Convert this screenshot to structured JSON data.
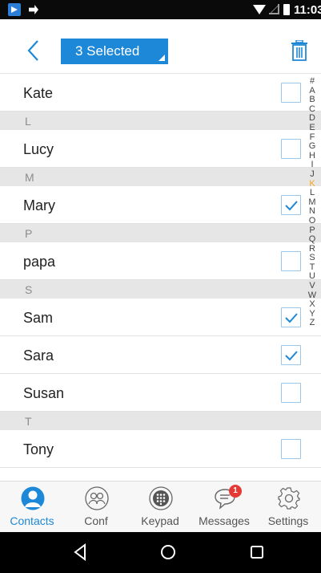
{
  "status_bar": {
    "time": "11:03"
  },
  "toolbar": {
    "selection_label": "3 Selected"
  },
  "contacts": [
    {
      "type": "contact",
      "name": "Kate",
      "checked": false
    },
    {
      "type": "section",
      "letter": "L"
    },
    {
      "type": "contact",
      "name": "Lucy",
      "checked": false
    },
    {
      "type": "section",
      "letter": "M"
    },
    {
      "type": "contact",
      "name": "Mary",
      "checked": true
    },
    {
      "type": "section",
      "letter": "P"
    },
    {
      "type": "contact",
      "name": "papa",
      "checked": false
    },
    {
      "type": "section",
      "letter": "S"
    },
    {
      "type": "contact",
      "name": "Sam",
      "checked": true
    },
    {
      "type": "contact",
      "name": "Sara",
      "checked": true
    },
    {
      "type": "contact",
      "name": "Susan",
      "checked": false
    },
    {
      "type": "section",
      "letter": "T"
    },
    {
      "type": "contact",
      "name": "Tony",
      "checked": false
    }
  ],
  "alphabet_index": [
    "#",
    "A",
    "B",
    "C",
    "D",
    "E",
    "F",
    "G",
    "H",
    "I",
    "J",
    "K",
    "L",
    "M",
    "N",
    "O",
    "P",
    "Q",
    "R",
    "S",
    "T",
    "U",
    "V",
    "W",
    "X",
    "Y",
    "Z"
  ],
  "alphabet_active": "K",
  "tabs": [
    {
      "label": "Contacts",
      "icon": "person-icon",
      "active": true
    },
    {
      "label": "Conf",
      "icon": "conference-icon",
      "active": false
    },
    {
      "label": "Keypad",
      "icon": "keypad-icon",
      "active": false
    },
    {
      "label": "Messages",
      "icon": "chat-bubble-icon",
      "active": false,
      "badge": "1"
    },
    {
      "label": "Settings",
      "icon": "gear-icon",
      "active": false
    }
  ],
  "colors": {
    "accent": "#1e88d8",
    "index_active": "#f5a623",
    "badge": "#e53935",
    "section_bg": "#e6e6e6"
  }
}
